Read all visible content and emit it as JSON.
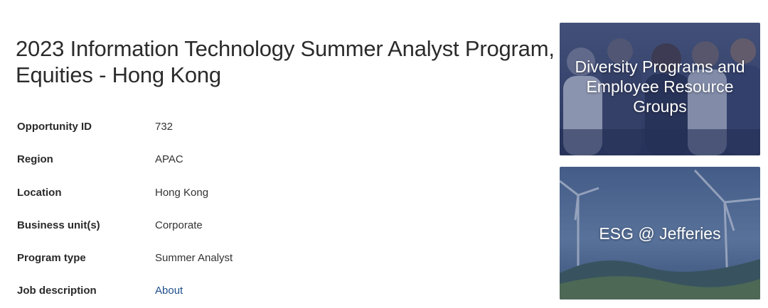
{
  "job": {
    "title": "2023 Information Technology Summer Analyst Program, Equities - Hong Kong",
    "details": [
      {
        "label": "Opportunity ID",
        "value": "732"
      },
      {
        "label": "Region",
        "value": "APAC"
      },
      {
        "label": "Location",
        "value": "Hong Kong"
      },
      {
        "label": "Business unit(s)",
        "value": "Corporate"
      },
      {
        "label": "Program type",
        "value": "Summer Analyst"
      },
      {
        "label": "Job description",
        "value": "About"
      }
    ]
  },
  "sidebar": {
    "cards": [
      {
        "label": "Diversity Programs and Employee Resource Groups"
      },
      {
        "label": "ESG @ Jefferies"
      }
    ]
  },
  "colors": {
    "link": "#1f4e8c",
    "card_overlay": "#2d3f73"
  }
}
